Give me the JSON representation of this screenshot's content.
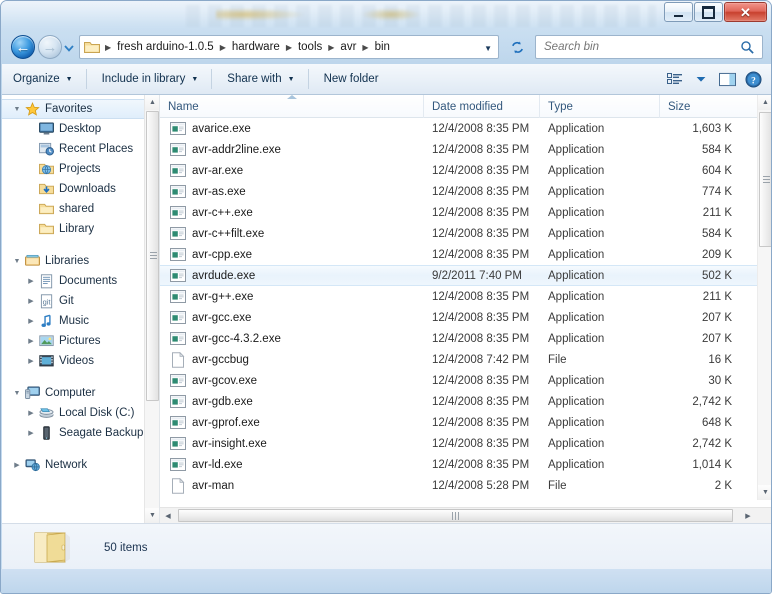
{
  "window": {
    "title": "",
    "controls": {
      "minimize": "Minimize",
      "maximize": "Maximize",
      "close": "Close"
    }
  },
  "address_bar": {
    "back": "Back",
    "forward": "Forward",
    "history_dropdown": "Recent locations",
    "breadcrumb": [
      "fresh arduino-1.0.5",
      "hardware",
      "tools",
      "avr",
      "bin"
    ],
    "path_dropdown": "Previous locations",
    "refresh": "Refresh"
  },
  "search": {
    "placeholder": "Search bin",
    "value": ""
  },
  "toolbar": {
    "items": [
      {
        "label": "Organize",
        "has_caret": true
      },
      {
        "label": "Include in library",
        "has_caret": true
      },
      {
        "label": "Share with",
        "has_caret": true
      },
      {
        "label": "New folder",
        "has_caret": false
      }
    ],
    "view_label": "Change your view",
    "preview_label": "Show the preview pane",
    "help_label": "Get help"
  },
  "navpane": {
    "groups": [
      {
        "header": {
          "label": "Favorites",
          "icon": "star-icon",
          "expanded": true,
          "selected": true
        },
        "items": [
          {
            "label": "Desktop",
            "icon": "desktop-icon",
            "expander": false
          },
          {
            "label": "Recent Places",
            "icon": "recent-places-icon",
            "expander": false
          },
          {
            "label": "Projects",
            "icon": "projects-folder-icon",
            "expander": false
          },
          {
            "label": "Downloads",
            "icon": "downloads-folder-icon",
            "expander": false
          },
          {
            "label": "shared",
            "icon": "folder-icon",
            "expander": false
          },
          {
            "label": "Library",
            "icon": "folder-icon",
            "expander": false
          }
        ]
      },
      {
        "header": {
          "label": "Libraries",
          "icon": "libraries-icon",
          "expanded": true,
          "selected": false
        },
        "items": [
          {
            "label": "Documents",
            "icon": "documents-library-icon",
            "expander": true
          },
          {
            "label": "Git",
            "icon": "git-library-icon",
            "expander": true
          },
          {
            "label": "Music",
            "icon": "music-library-icon",
            "expander": true
          },
          {
            "label": "Pictures",
            "icon": "pictures-library-icon",
            "expander": true
          },
          {
            "label": "Videos",
            "icon": "videos-library-icon",
            "expander": true
          }
        ]
      },
      {
        "header": {
          "label": "Computer",
          "icon": "computer-icon",
          "expanded": true,
          "selected": false
        },
        "items": [
          {
            "label": "Local Disk (C:)",
            "icon": "hard-disk-icon",
            "expander": true
          },
          {
            "label": "Seagate Backup P",
            "icon": "external-drive-icon",
            "expander": true
          }
        ]
      },
      {
        "header": {
          "label": "Network",
          "icon": "network-icon",
          "expanded": false,
          "selected": false
        },
        "items": []
      }
    ]
  },
  "filelist": {
    "columns": [
      {
        "label": "Name",
        "sorted": true
      },
      {
        "label": "Date modified",
        "sorted": false
      },
      {
        "label": "Type",
        "sorted": false
      },
      {
        "label": "Size",
        "sorted": false
      }
    ],
    "rows": [
      {
        "name": "avarice.exe",
        "icon": "application-icon",
        "date": "12/4/2008 8:35 PM",
        "type": "Application",
        "size": "1,603 K",
        "selected": false
      },
      {
        "name": "avr-addr2line.exe",
        "icon": "application-icon",
        "date": "12/4/2008 8:35 PM",
        "type": "Application",
        "size": "584 K",
        "selected": false
      },
      {
        "name": "avr-ar.exe",
        "icon": "application-icon",
        "date": "12/4/2008 8:35 PM",
        "type": "Application",
        "size": "604 K",
        "selected": false
      },
      {
        "name": "avr-as.exe",
        "icon": "application-icon",
        "date": "12/4/2008 8:35 PM",
        "type": "Application",
        "size": "774 K",
        "selected": false
      },
      {
        "name": "avr-c++.exe",
        "icon": "application-icon",
        "date": "12/4/2008 8:35 PM",
        "type": "Application",
        "size": "211 K",
        "selected": false
      },
      {
        "name": "avr-c++filt.exe",
        "icon": "application-icon",
        "date": "12/4/2008 8:35 PM",
        "type": "Application",
        "size": "584 K",
        "selected": false
      },
      {
        "name": "avr-cpp.exe",
        "icon": "application-icon",
        "date": "12/4/2008 8:35 PM",
        "type": "Application",
        "size": "209 K",
        "selected": false
      },
      {
        "name": "avrdude.exe",
        "icon": "application-icon",
        "date": "9/2/2011 7:40 PM",
        "type": "Application",
        "size": "502 K",
        "selected": true
      },
      {
        "name": "avr-g++.exe",
        "icon": "application-icon",
        "date": "12/4/2008 8:35 PM",
        "type": "Application",
        "size": "211 K",
        "selected": false
      },
      {
        "name": "avr-gcc.exe",
        "icon": "application-icon",
        "date": "12/4/2008 8:35 PM",
        "type": "Application",
        "size": "207 K",
        "selected": false
      },
      {
        "name": "avr-gcc-4.3.2.exe",
        "icon": "application-icon",
        "date": "12/4/2008 8:35 PM",
        "type": "Application",
        "size": "207 K",
        "selected": false
      },
      {
        "name": "avr-gccbug",
        "icon": "file-icon",
        "date": "12/4/2008 7:42 PM",
        "type": "File",
        "size": "16 K",
        "selected": false
      },
      {
        "name": "avr-gcov.exe",
        "icon": "application-icon",
        "date": "12/4/2008 8:35 PM",
        "type": "Application",
        "size": "30 K",
        "selected": false
      },
      {
        "name": "avr-gdb.exe",
        "icon": "application-icon",
        "date": "12/4/2008 8:35 PM",
        "type": "Application",
        "size": "2,742 K",
        "selected": false
      },
      {
        "name": "avr-gprof.exe",
        "icon": "application-icon",
        "date": "12/4/2008 8:35 PM",
        "type": "Application",
        "size": "648 K",
        "selected": false
      },
      {
        "name": "avr-insight.exe",
        "icon": "application-icon",
        "date": "12/4/2008 8:35 PM",
        "type": "Application",
        "size": "2,742 K",
        "selected": false
      },
      {
        "name": "avr-ld.exe",
        "icon": "application-icon",
        "date": "12/4/2008 8:35 PM",
        "type": "Application",
        "size": "1,014 K",
        "selected": false
      },
      {
        "name": "avr-man",
        "icon": "file-icon",
        "date": "12/4/2008 5:28 PM",
        "type": "File",
        "size": "2 K",
        "selected": false
      }
    ]
  },
  "statusbar": {
    "icon": "folder-icon",
    "text": "50 items"
  },
  "colors": {
    "accent": "#2f7fc4",
    "header_text": "#33587d",
    "selection": "#e9f3fc",
    "close_button": "#c8412f",
    "exe_icon_green": "#2e8b72",
    "folder_yellow": "#f4d47c"
  }
}
